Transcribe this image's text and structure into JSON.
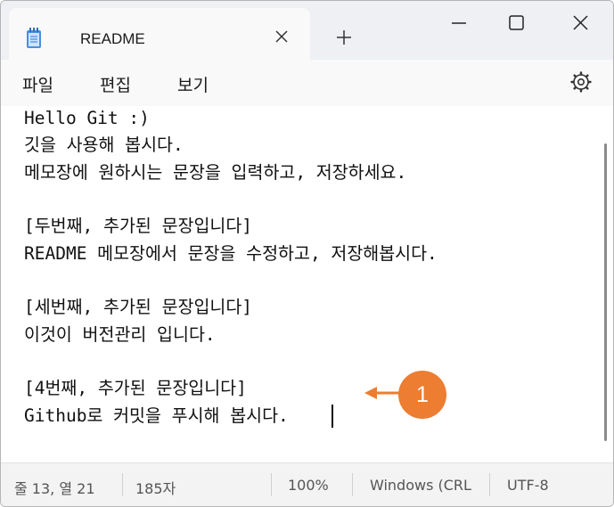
{
  "tab": {
    "title": "README",
    "icon": "notepad-icon",
    "close_icon": "close-icon",
    "new_tab_icon": "plus-icon"
  },
  "window_controls": {
    "minimize": "minimize-icon",
    "maximize": "maximize-icon",
    "close": "close-icon"
  },
  "menu": {
    "file": "파일",
    "edit": "편집",
    "view": "보기",
    "settings_icon": "gear-icon"
  },
  "editor": {
    "lines": [
      "Hello Git :)",
      "깃을 사용해 봅시다.",
      "메모장에 원하시는 문장을 입력하고, 저장하세요.",
      "",
      "[두번째, 추가된 문장입니다]",
      "README 메모장에서 문장을 수정하고, 저장해봅시다.",
      "",
      "[세번째, 추가된 문장입니다]",
      "이것이 버전관리 입니다.",
      "",
      "[4번째, 추가된 문장입니다]",
      "Github로 커밋을 푸시해 봅시다."
    ]
  },
  "callout": {
    "number": "1",
    "color": "#ec7d31"
  },
  "status": {
    "position": "줄 13, 열 21",
    "chars": "185자",
    "zoom": "100%",
    "line_ending": "Windows (CRL",
    "encoding": "UTF-8"
  }
}
